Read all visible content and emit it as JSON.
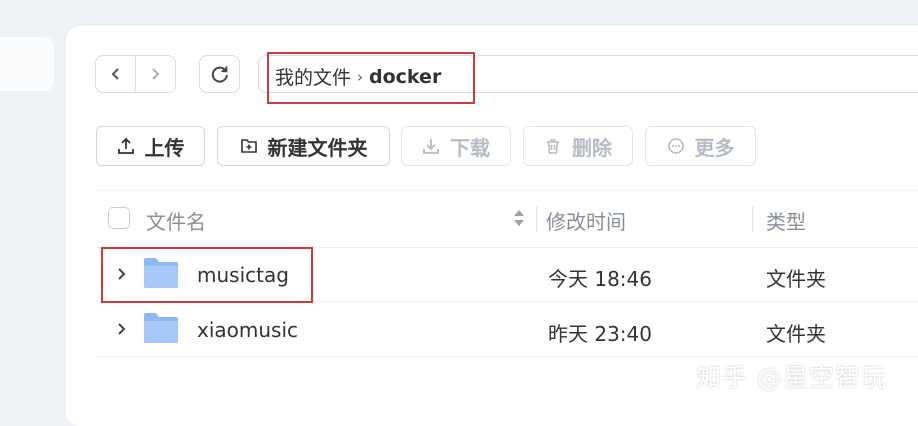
{
  "breadcrumb": {
    "root": "我的文件",
    "separator": "›",
    "current": "docker"
  },
  "toolbar": {
    "upload": "上传",
    "new_folder": "新建文件夹",
    "download": "下载",
    "delete": "删除",
    "more": "更多"
  },
  "table": {
    "columns": {
      "name": "文件名",
      "modified": "修改时间",
      "type": "类型"
    },
    "rows": [
      {
        "name": "musictag",
        "modified": "今天 18:46",
        "type": "文件夹"
      },
      {
        "name": "xiaomusic",
        "modified": "昨天 23:40",
        "type": "文件夹"
      }
    ]
  },
  "watermark": "知乎 @星空智玩",
  "colors": {
    "highlight": "#d23a3a",
    "folder": "#8db8f2",
    "disabled_text": "#b6bcc5"
  }
}
